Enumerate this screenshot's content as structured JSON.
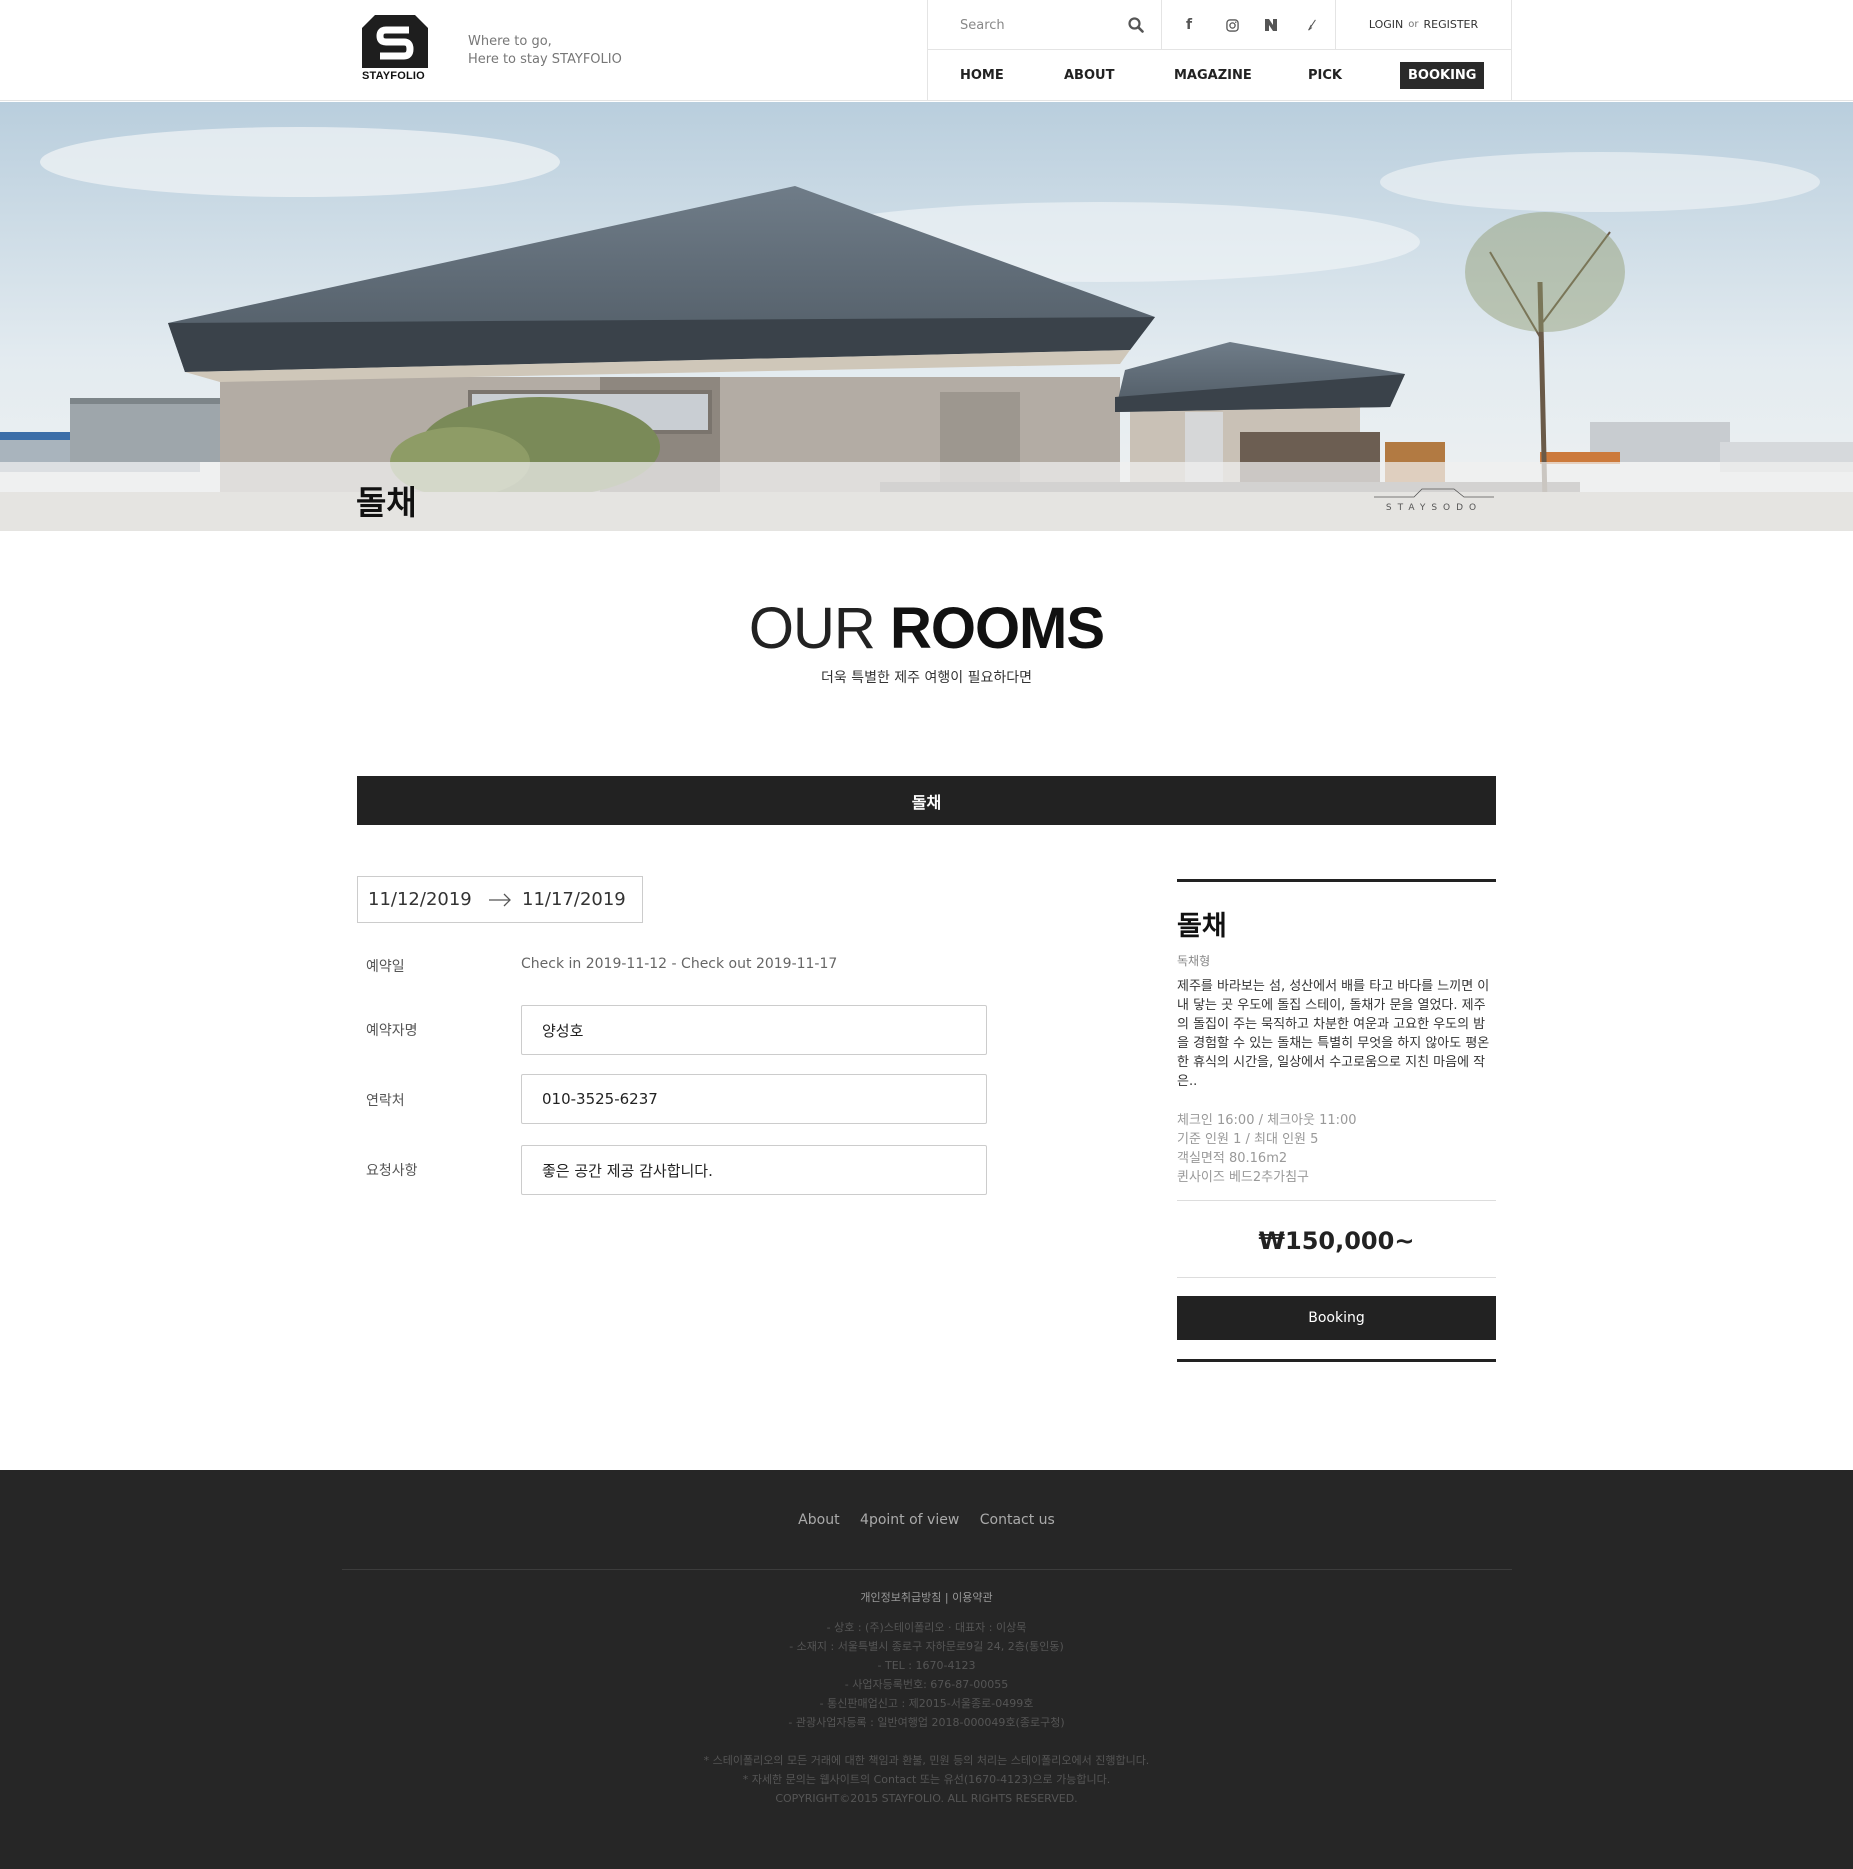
{
  "brand": {
    "logo_text": "STAYFOLIO",
    "tagline_line1": "Where to go,",
    "tagline_line2": "Here to stay STAYFOLIO"
  },
  "header": {
    "search_placeholder": "Search",
    "login": "LOGIN",
    "or": "or",
    "register": "REGISTER",
    "social_icons": [
      "facebook-icon",
      "instagram-icon",
      "naver-icon",
      "brunch-icon"
    ],
    "nav": [
      "HOME",
      "ABOUT",
      "MAGAZINE",
      "PICK",
      "BOOKING"
    ]
  },
  "hero": {
    "title": "돌채",
    "brand_mark": "STAYSODO"
  },
  "rooms_section": {
    "heading_light": "OUR",
    "heading_bold": "ROOMS",
    "subtitle": "더욱 특별한 제주 여행이 필요하다면",
    "room_tab": "돌채"
  },
  "booking_form": {
    "check_in_date": "11/12/2019",
    "check_out_date": "11/17/2019",
    "fields": [
      {
        "label": "예약일",
        "value": "Check in 2019-11-12 - Check out 2019-11-17"
      },
      {
        "label": "예약자명",
        "value": "양성호"
      },
      {
        "label": "연락처",
        "value": "010-3525-6237"
      },
      {
        "label": "요청사항",
        "value": "좋은 공간 제공 감사합니다."
      }
    ]
  },
  "room_card": {
    "title": "돌채",
    "type": "독채형",
    "description": "제주를 바라보는 섬, 성산에서 배를 타고 바다를 느끼면 이내 닿는 곳 우도에 돌집 스테이, 돌채가 문을 열었다. 제주의 돌집이 주는 묵직하고 차분한 여운과 고요한 우도의 밤을 경험할 수 있는 돌채는 특별히 무엇을 하지 않아도 평온한 휴식의 시간을, 일상에서 수고로움으로 지친 마음에 작은..",
    "info": [
      "체크인 16:00 / 체크아웃 11:00",
      "기준 인원 1 / 최대 인원 5",
      "객실면적 80.16m2",
      "퀸사이즈 베드2추가침구"
    ],
    "price": "₩150,000~",
    "button": "Booking"
  },
  "footer": {
    "links": [
      "About",
      "4point of view",
      "Contact us"
    ],
    "policy": "개인정보취급방침 | 이용약관",
    "company": [
      "- 상호 : (주)스테이폴리오 · 대표자 : 이상묵",
      "- 소재지 : 서울특별시 종로구 자하문로9길 24, 2층(통인동)",
      "- TEL : 1670-4123",
      "- 사업자등록번호: 676-87-00055",
      "- 통신판매업신고 : 제2015-서울종로-0499호",
      "- 관광사업자등록 : 일반여행업 2018-000049호(종로구청)"
    ],
    "notice": [
      "* 스테이폴리오의 모든 거래에 대한 책임과 환불, 민원 등의 처리는 스테이폴리오에서 진행합니다.",
      "* 자세한 문의는 웹사이트의 Contact 또는 유선(1670-4123)으로 가능합니다.",
      "COPYRIGHT©2015 STAYFOLIO. ALL RIGHTS RESERVED."
    ]
  },
  "colors": {
    "dark": "#222222",
    "footer_bg": "#262626",
    "border": "#cccccc"
  }
}
